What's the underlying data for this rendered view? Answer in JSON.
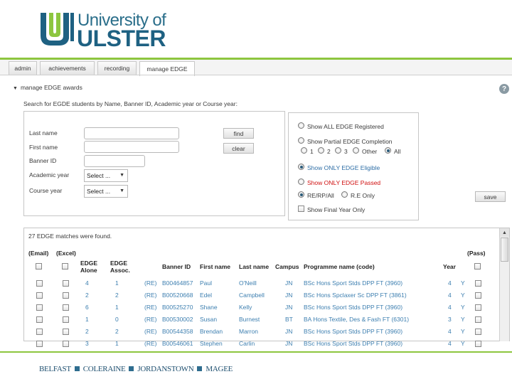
{
  "brand": {
    "line1": "University of",
    "line2": "ULSTER",
    "colors": {
      "green": "#8dc63f",
      "blue": "#1e6182"
    }
  },
  "tabs": [
    {
      "label": "admin",
      "active": false
    },
    {
      "label": "achievements",
      "active": false
    },
    {
      "label": "recording",
      "active": false
    },
    {
      "label": "manage EDGE",
      "active": true
    }
  ],
  "panel": {
    "title": "manage EDGE awards",
    "help_icon": "help-icon"
  },
  "search": {
    "caption": "Search for EGDE students by Name, Banner ID, Academic year or Course year:",
    "labels": {
      "last_name": "Last name",
      "first_name": "First name",
      "banner_id": "Banner ID",
      "academic_year": "Academic year",
      "course_year": "Course year"
    },
    "values": {
      "last_name": "",
      "first_name": "",
      "banner_id": ""
    },
    "find_label": "find",
    "clear_label": "clear",
    "academic_year_selected": "Select ...",
    "course_year_selected": "Select ..."
  },
  "options": {
    "show_all": "Show ALL EDGE Registered",
    "show_partial": "Show Partial EDGE Completion",
    "years": [
      "1",
      "2",
      "3",
      "Other",
      "All"
    ],
    "show_eligible": "Show ONLY EDGE Eligible",
    "show_passed": "Show ONLY EDGE Passed",
    "re_rp_all": "RE/RP/All",
    "re_only": "R.E Only",
    "final_year": "Show Final Year Only",
    "save_label": "save",
    "colors": {
      "eligible": "#2e6ea6",
      "passed": "#d01010"
    }
  },
  "results": {
    "summary": "27 EDGE matches were found.",
    "email_label": "(Email)",
    "excel_label": "(Excel)",
    "pass_label": "(Pass)",
    "columns": {
      "edge_alone": "EDGE Alone",
      "edge_assoc": "EDGE Assoc.",
      "banner_id": "Banner ID",
      "first_name": "First name",
      "last_name": "Last name",
      "campus": "Campus",
      "programme": "Programme name (code)",
      "year": "Year"
    },
    "rows": [
      {
        "alone": "4",
        "assoc": "1",
        "re": "(RE)",
        "banner": "B00464857",
        "first": "Paul",
        "last": "O'Neill",
        "campus": "JN",
        "programme": "BSc Hons Sport Stds DPP FT (3960)",
        "year": "4",
        "flag": "Y"
      },
      {
        "alone": "2",
        "assoc": "2",
        "re": "(RE)",
        "banner": "B00520668",
        "first": "Edel",
        "last": "Campbell",
        "campus": "JN",
        "programme": "BSc Hons Spclaxer Sc DPP FT (3861)",
        "year": "4",
        "flag": "Y"
      },
      {
        "alone": "6",
        "assoc": "1",
        "re": "(RE)",
        "banner": "B00525270",
        "first": "Shane",
        "last": "Kelly",
        "campus": "JN",
        "programme": "BSc Hons Sport Stds DPP FT (3960)",
        "year": "4",
        "flag": "Y"
      },
      {
        "alone": "1",
        "assoc": "0",
        "re": "(RE)",
        "banner": "B00530002",
        "first": "Susan",
        "last": "Burnest",
        "campus": "BT",
        "programme": "BA Hons Textile, Des & Fash FT (6301)",
        "year": "3",
        "flag": "Y"
      },
      {
        "alone": "2",
        "assoc": "2",
        "re": "(RE)",
        "banner": "B00544358",
        "first": "Brendan",
        "last": "Marron",
        "campus": "JN",
        "programme": "BSc Hons Sport Stds DPP FT (3960)",
        "year": "4",
        "flag": "Y"
      },
      {
        "alone": "3",
        "assoc": "1",
        "re": "(RE)",
        "banner": "B00546061",
        "first": "Stephen",
        "last": "Carlin",
        "campus": "JN",
        "programme": "BSc Hons Sport Stds DPP FT (3960)",
        "year": "4",
        "flag": "Y"
      }
    ]
  },
  "footer": {
    "campuses": [
      "BELFAST",
      "COLERAINE",
      "JORDANSTOWN",
      "MAGEE"
    ]
  }
}
